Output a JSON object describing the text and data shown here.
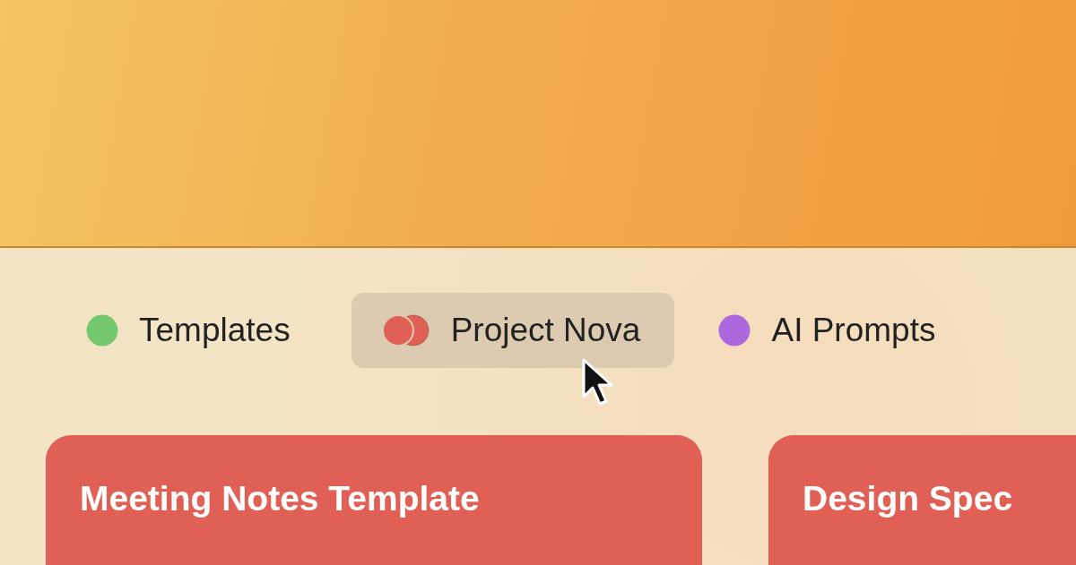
{
  "tabs": [
    {
      "label": "Templates",
      "color": "#74c96f",
      "kind": "single",
      "selected": false
    },
    {
      "label": "Project Nova",
      "color": "#e06055",
      "kind": "stacked",
      "selected": true
    },
    {
      "label": "AI Prompts",
      "color": "#ae68dd",
      "kind": "single",
      "selected": false
    }
  ],
  "cards": [
    {
      "title": "Meeting Notes Template"
    },
    {
      "title": "Design Spec"
    }
  ]
}
